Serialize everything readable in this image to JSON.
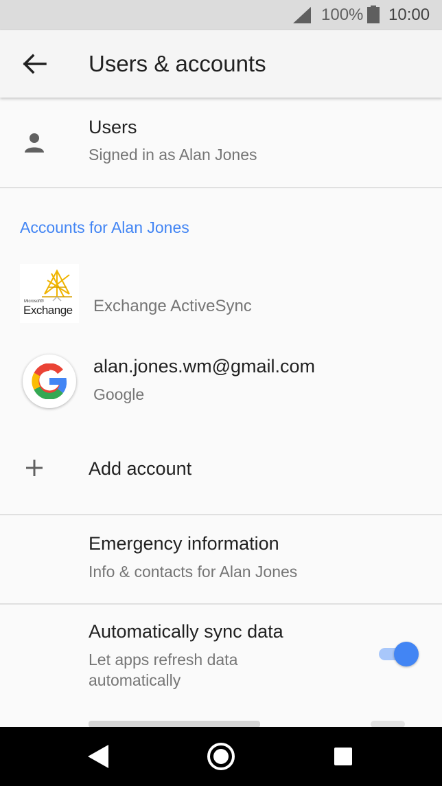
{
  "status_bar": {
    "battery_percent": "100%",
    "time": "10:00",
    "icons": [
      "signal-icon",
      "battery-icon"
    ]
  },
  "app_bar": {
    "title": "Users & accounts",
    "back_icon": "back-arrow-icon"
  },
  "users_row": {
    "title": "Users",
    "subtitle": "Signed in as Alan Jones",
    "icon": "person-icon"
  },
  "accounts_section": {
    "header": "Accounts for Alan Jones",
    "accounts": [
      {
        "name": "",
        "type": "Exchange ActiveSync",
        "icon": "exchange-logo-icon",
        "logo_text": {
          "small": "Microsoft®",
          "large": "Exchange"
        }
      },
      {
        "name": "alan.jones.wm@gmail.com",
        "type": "Google",
        "icon": "google-logo-icon"
      }
    ],
    "add_account": {
      "label": "Add account",
      "icon": "plus-icon"
    }
  },
  "emergency": {
    "title": "Emergency information",
    "subtitle": "Info & contacts for Alan Jones"
  },
  "auto_sync": {
    "title": "Automatically sync data",
    "subtitle_line1": "Let apps refresh data",
    "subtitle_line2": "automatically",
    "enabled": true
  },
  "nav_bar": {
    "buttons": [
      "back-triangle-icon",
      "home-circle-icon",
      "recents-square-icon"
    ]
  },
  "colors": {
    "accent": "#4285f4",
    "background": "#fafafa",
    "status_bar": "#dcdcdc",
    "nav_bar": "#000000"
  }
}
